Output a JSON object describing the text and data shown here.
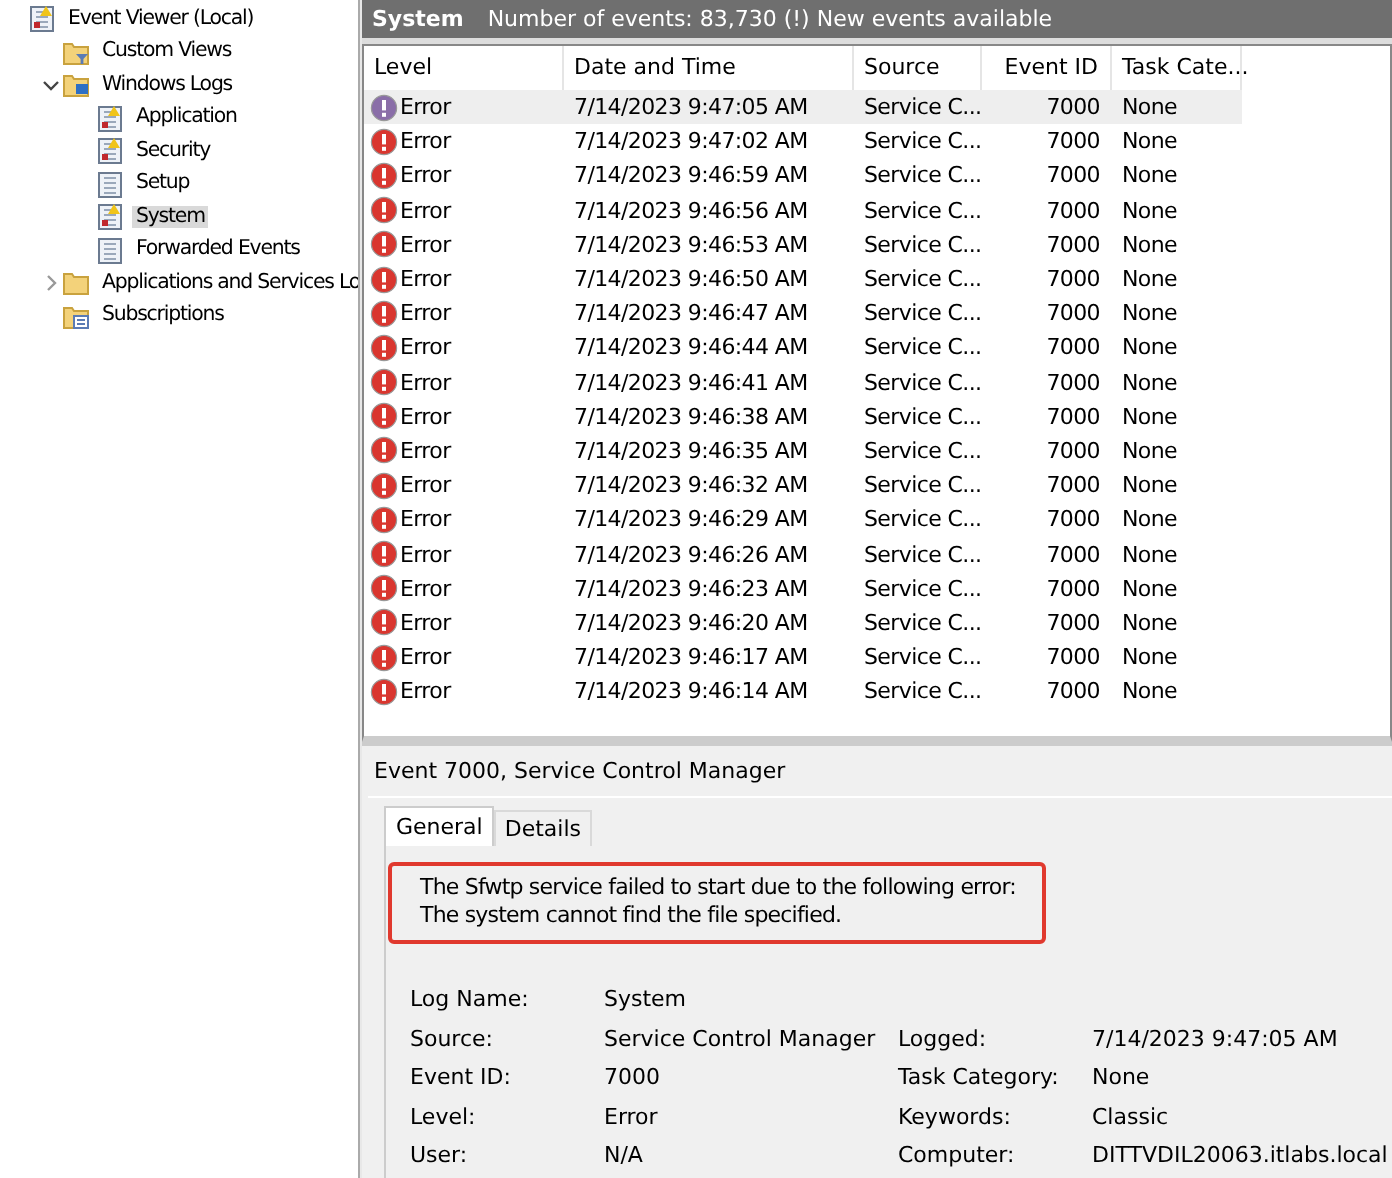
{
  "tree": [
    {
      "label": "Event Viewer (Local)",
      "kind": "viewer",
      "selected": false,
      "children": [
        {
          "label": "Custom Views",
          "kind": "filter-folder",
          "selected": false
        },
        {
          "label": "Windows Logs",
          "kind": "log-folder",
          "selected": false,
          "expanded": true,
          "children": [
            {
              "label": "Application",
              "kind": "log-warn",
              "selected": false
            },
            {
              "label": "Security",
              "kind": "log-warn",
              "selected": false
            },
            {
              "label": "Setup",
              "kind": "log",
              "selected": false
            },
            {
              "label": "System",
              "kind": "log-warn",
              "selected": true
            },
            {
              "label": "Forwarded Events",
              "kind": "log",
              "selected": false
            }
          ]
        },
        {
          "label": "Applications and Services Lo",
          "kind": "folder",
          "selected": false,
          "expanded": false
        },
        {
          "label": "Subscriptions",
          "kind": "subs",
          "selected": false
        }
      ]
    }
  ],
  "header": {
    "title": "System",
    "info": "Number of events: 83,730 (!) New events available"
  },
  "table": {
    "columns": [
      "Level",
      "Date and Time",
      "Source",
      "Event ID",
      "Task Cate..."
    ],
    "rows": [
      {
        "level": "Error",
        "time": "7/14/2023 9:47:05 AM",
        "source": "Service C...",
        "id": "7000",
        "category": "None",
        "selected": true
      },
      {
        "level": "Error",
        "time": "7/14/2023 9:47:02 AM",
        "source": "Service C...",
        "id": "7000",
        "category": "None",
        "selected": false
      },
      {
        "level": "Error",
        "time": "7/14/2023 9:46:59 AM",
        "source": "Service C...",
        "id": "7000",
        "category": "None",
        "selected": false
      },
      {
        "level": "Error",
        "time": "7/14/2023 9:46:56 AM",
        "source": "Service C...",
        "id": "7000",
        "category": "None",
        "selected": false
      },
      {
        "level": "Error",
        "time": "7/14/2023 9:46:53 AM",
        "source": "Service C...",
        "id": "7000",
        "category": "None",
        "selected": false
      },
      {
        "level": "Error",
        "time": "7/14/2023 9:46:50 AM",
        "source": "Service C...",
        "id": "7000",
        "category": "None",
        "selected": false
      },
      {
        "level": "Error",
        "time": "7/14/2023 9:46:47 AM",
        "source": "Service C...",
        "id": "7000",
        "category": "None",
        "selected": false
      },
      {
        "level": "Error",
        "time": "7/14/2023 9:46:44 AM",
        "source": "Service C...",
        "id": "7000",
        "category": "None",
        "selected": false
      },
      {
        "level": "Error",
        "time": "7/14/2023 9:46:41 AM",
        "source": "Service C...",
        "id": "7000",
        "category": "None",
        "selected": false
      },
      {
        "level": "Error",
        "time": "7/14/2023 9:46:38 AM",
        "source": "Service C...",
        "id": "7000",
        "category": "None",
        "selected": false
      },
      {
        "level": "Error",
        "time": "7/14/2023 9:46:35 AM",
        "source": "Service C...",
        "id": "7000",
        "category": "None",
        "selected": false
      },
      {
        "level": "Error",
        "time": "7/14/2023 9:46:32 AM",
        "source": "Service C...",
        "id": "7000",
        "category": "None",
        "selected": false
      },
      {
        "level": "Error",
        "time": "7/14/2023 9:46:29 AM",
        "source": "Service C...",
        "id": "7000",
        "category": "None",
        "selected": false
      },
      {
        "level": "Error",
        "time": "7/14/2023 9:46:26 AM",
        "source": "Service C...",
        "id": "7000",
        "category": "None",
        "selected": false
      },
      {
        "level": "Error",
        "time": "7/14/2023 9:46:23 AM",
        "source": "Service C...",
        "id": "7000",
        "category": "None",
        "selected": false
      },
      {
        "level": "Error",
        "time": "7/14/2023 9:46:20 AM",
        "source": "Service C...",
        "id": "7000",
        "category": "None",
        "selected": false
      },
      {
        "level": "Error",
        "time": "7/14/2023 9:46:17 AM",
        "source": "Service C...",
        "id": "7000",
        "category": "None",
        "selected": false
      },
      {
        "level": "Error",
        "time": "7/14/2023 9:46:14 AM",
        "source": "Service C...",
        "id": "7000",
        "category": "None",
        "selected": false
      }
    ]
  },
  "detail": {
    "title": "Event 7000, Service Control Manager",
    "tabs": [
      {
        "label": "General",
        "selected": true
      },
      {
        "label": "Details",
        "selected": false
      }
    ],
    "message": [
      "The Sfwtp service failed to start due to the following error:",
      "The system cannot find the file specified."
    ],
    "highlighted": true,
    "properties": [
      [
        {
          "label": "Log Name:",
          "value": "System"
        }
      ],
      [
        {
          "label": "Source:",
          "value": "Service Control Manager"
        },
        {
          "label": "Logged:",
          "value": "7/14/2023 9:47:05 AM"
        }
      ],
      [
        {
          "label": "Event ID:",
          "value": "7000"
        },
        {
          "label": "Task Category:",
          "value": "None"
        }
      ],
      [
        {
          "label": "Level:",
          "value": "Error"
        },
        {
          "label": "Keywords:",
          "value": "Classic"
        }
      ],
      [
        {
          "label": "User:",
          "value": "N/A"
        },
        {
          "label": "Computer:",
          "value": "DITTVDIL20063.itlabs.local"
        }
      ]
    ]
  }
}
